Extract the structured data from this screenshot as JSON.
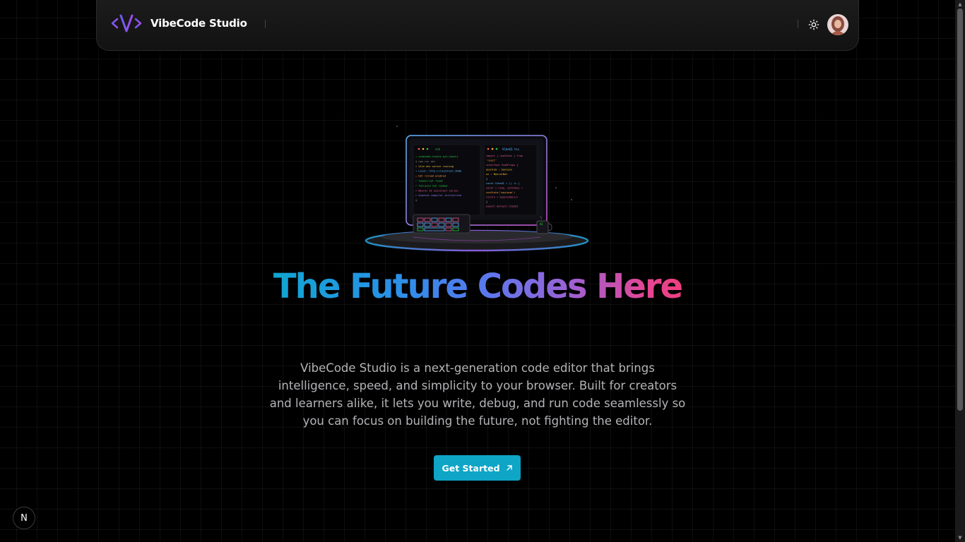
{
  "header": {
    "brand": "VibeCode Studio",
    "logo_icon": "vibecode-logo-icon",
    "theme_toggle_icon": "sun-icon",
    "avatar_icon": "user-avatar"
  },
  "hero": {
    "title": "The Future Codes Here",
    "description": "VibeCode Studio is a next-generation code editor that brings intelligence, speed, and simplicity to your browser. Built for creators and learners alike, it lets you write, debug, and run code seamlessly so you can focus on building the future, not fighting the editor.",
    "cta_label": "Get Started",
    "cta_icon": "arrow-up-right-icon"
  },
  "terminal": {
    "left_tab": "zsh",
    "left_lines": [
      "→ vibecode-studio git:(main)",
      "$ npm run dev",
      "⚡ Vite dev server running",
      "→ Local: http://localhost:3000",
      "⚠ Hot reload enabled",
      "✓ TypeScript ready",
      "✓ Tailwind CSS loaded",
      "⚛ Neural AI assistant online",
      "⚛ Quantum compiler initialized",
      "$"
    ],
    "right_tab": "VibeUI.tsx",
    "right_lines": [
      "import { useState } from",
      "'react'",
      "interface VibeProps {",
      "  quantum : boolean",
      "  ai : NeuralNet",
      "}",
      "const VibeUI = () => {",
      "  const [ vibe, setVibe] =",
      "  useState('maximum')",
      "  return < QuantumDiv/>",
      "}",
      "export default VibeUI"
    ],
    "mug_label": "AI"
  },
  "badge": {
    "label": "N"
  },
  "colors": {
    "accent": "#0ea5c6",
    "gradient_start": "#10a6d2",
    "gradient_end": "#ee3f80",
    "background": "#000000"
  }
}
